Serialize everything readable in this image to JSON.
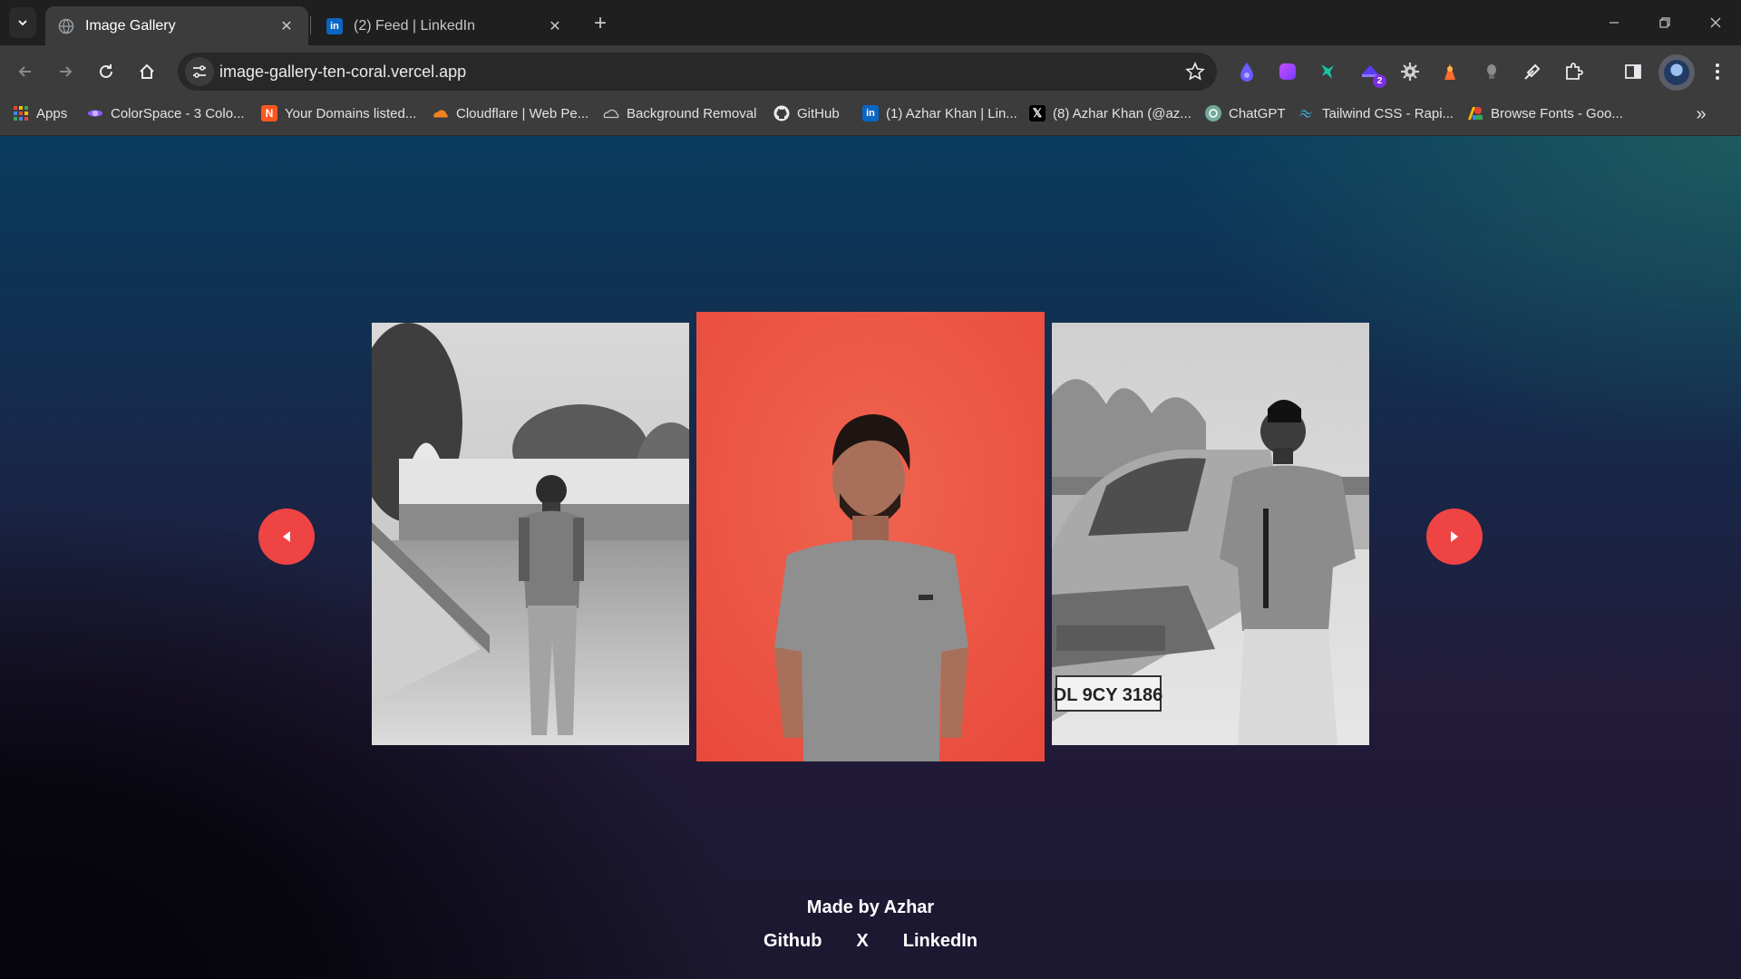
{
  "browser": {
    "tabs": [
      {
        "title": "Image Gallery",
        "favicon": "globe-icon",
        "active": true
      },
      {
        "title": "(2) Feed | LinkedIn",
        "favicon": "linkedin-icon",
        "active": false
      }
    ],
    "url": "image-gallery-ten-coral.vercel.app",
    "extension_badge": "2",
    "bookmarks": [
      {
        "label": "Apps",
        "icon": "apps-grid-icon"
      },
      {
        "label": "ColorSpace - 3 Colo...",
        "icon": "colorspace-icon"
      },
      {
        "label": "Your Domains listed...",
        "icon": "namecheap-icon"
      },
      {
        "label": "Cloudflare | Web Pe...",
        "icon": "cloudflare-icon"
      },
      {
        "label": "Background Removal",
        "icon": "cloud-icon"
      },
      {
        "label": "GitHub",
        "icon": "github-icon"
      },
      {
        "label": "(1) Azhar Khan | Lin...",
        "icon": "linkedin-icon"
      },
      {
        "label": "(8) Azhar Khan (@az...",
        "icon": "x-icon"
      },
      {
        "label": "ChatGPT",
        "icon": "chatgpt-icon"
      },
      {
        "label": "Tailwind CSS - Rapi...",
        "icon": "tailwind-icon"
      },
      {
        "label": "Browse Fonts - Goo...",
        "icon": "google-fonts-icon"
      }
    ]
  },
  "gallery": {
    "prev_icon": "caret-left-icon",
    "next_icon": "caret-right-icon",
    "accent_color": "#ef4444",
    "photos": [
      {
        "style": "grayscale",
        "scene": "man standing near fort gardens"
      },
      {
        "style": "color",
        "scene": "man in grey t-shirt against red wall"
      },
      {
        "style": "grayscale",
        "scene": "man leaning on car"
      }
    ],
    "plate": "DL 9CY 3186"
  },
  "footer": {
    "made_by": "Made by Azhar",
    "links": [
      "Github",
      "X",
      "LinkedIn"
    ]
  }
}
